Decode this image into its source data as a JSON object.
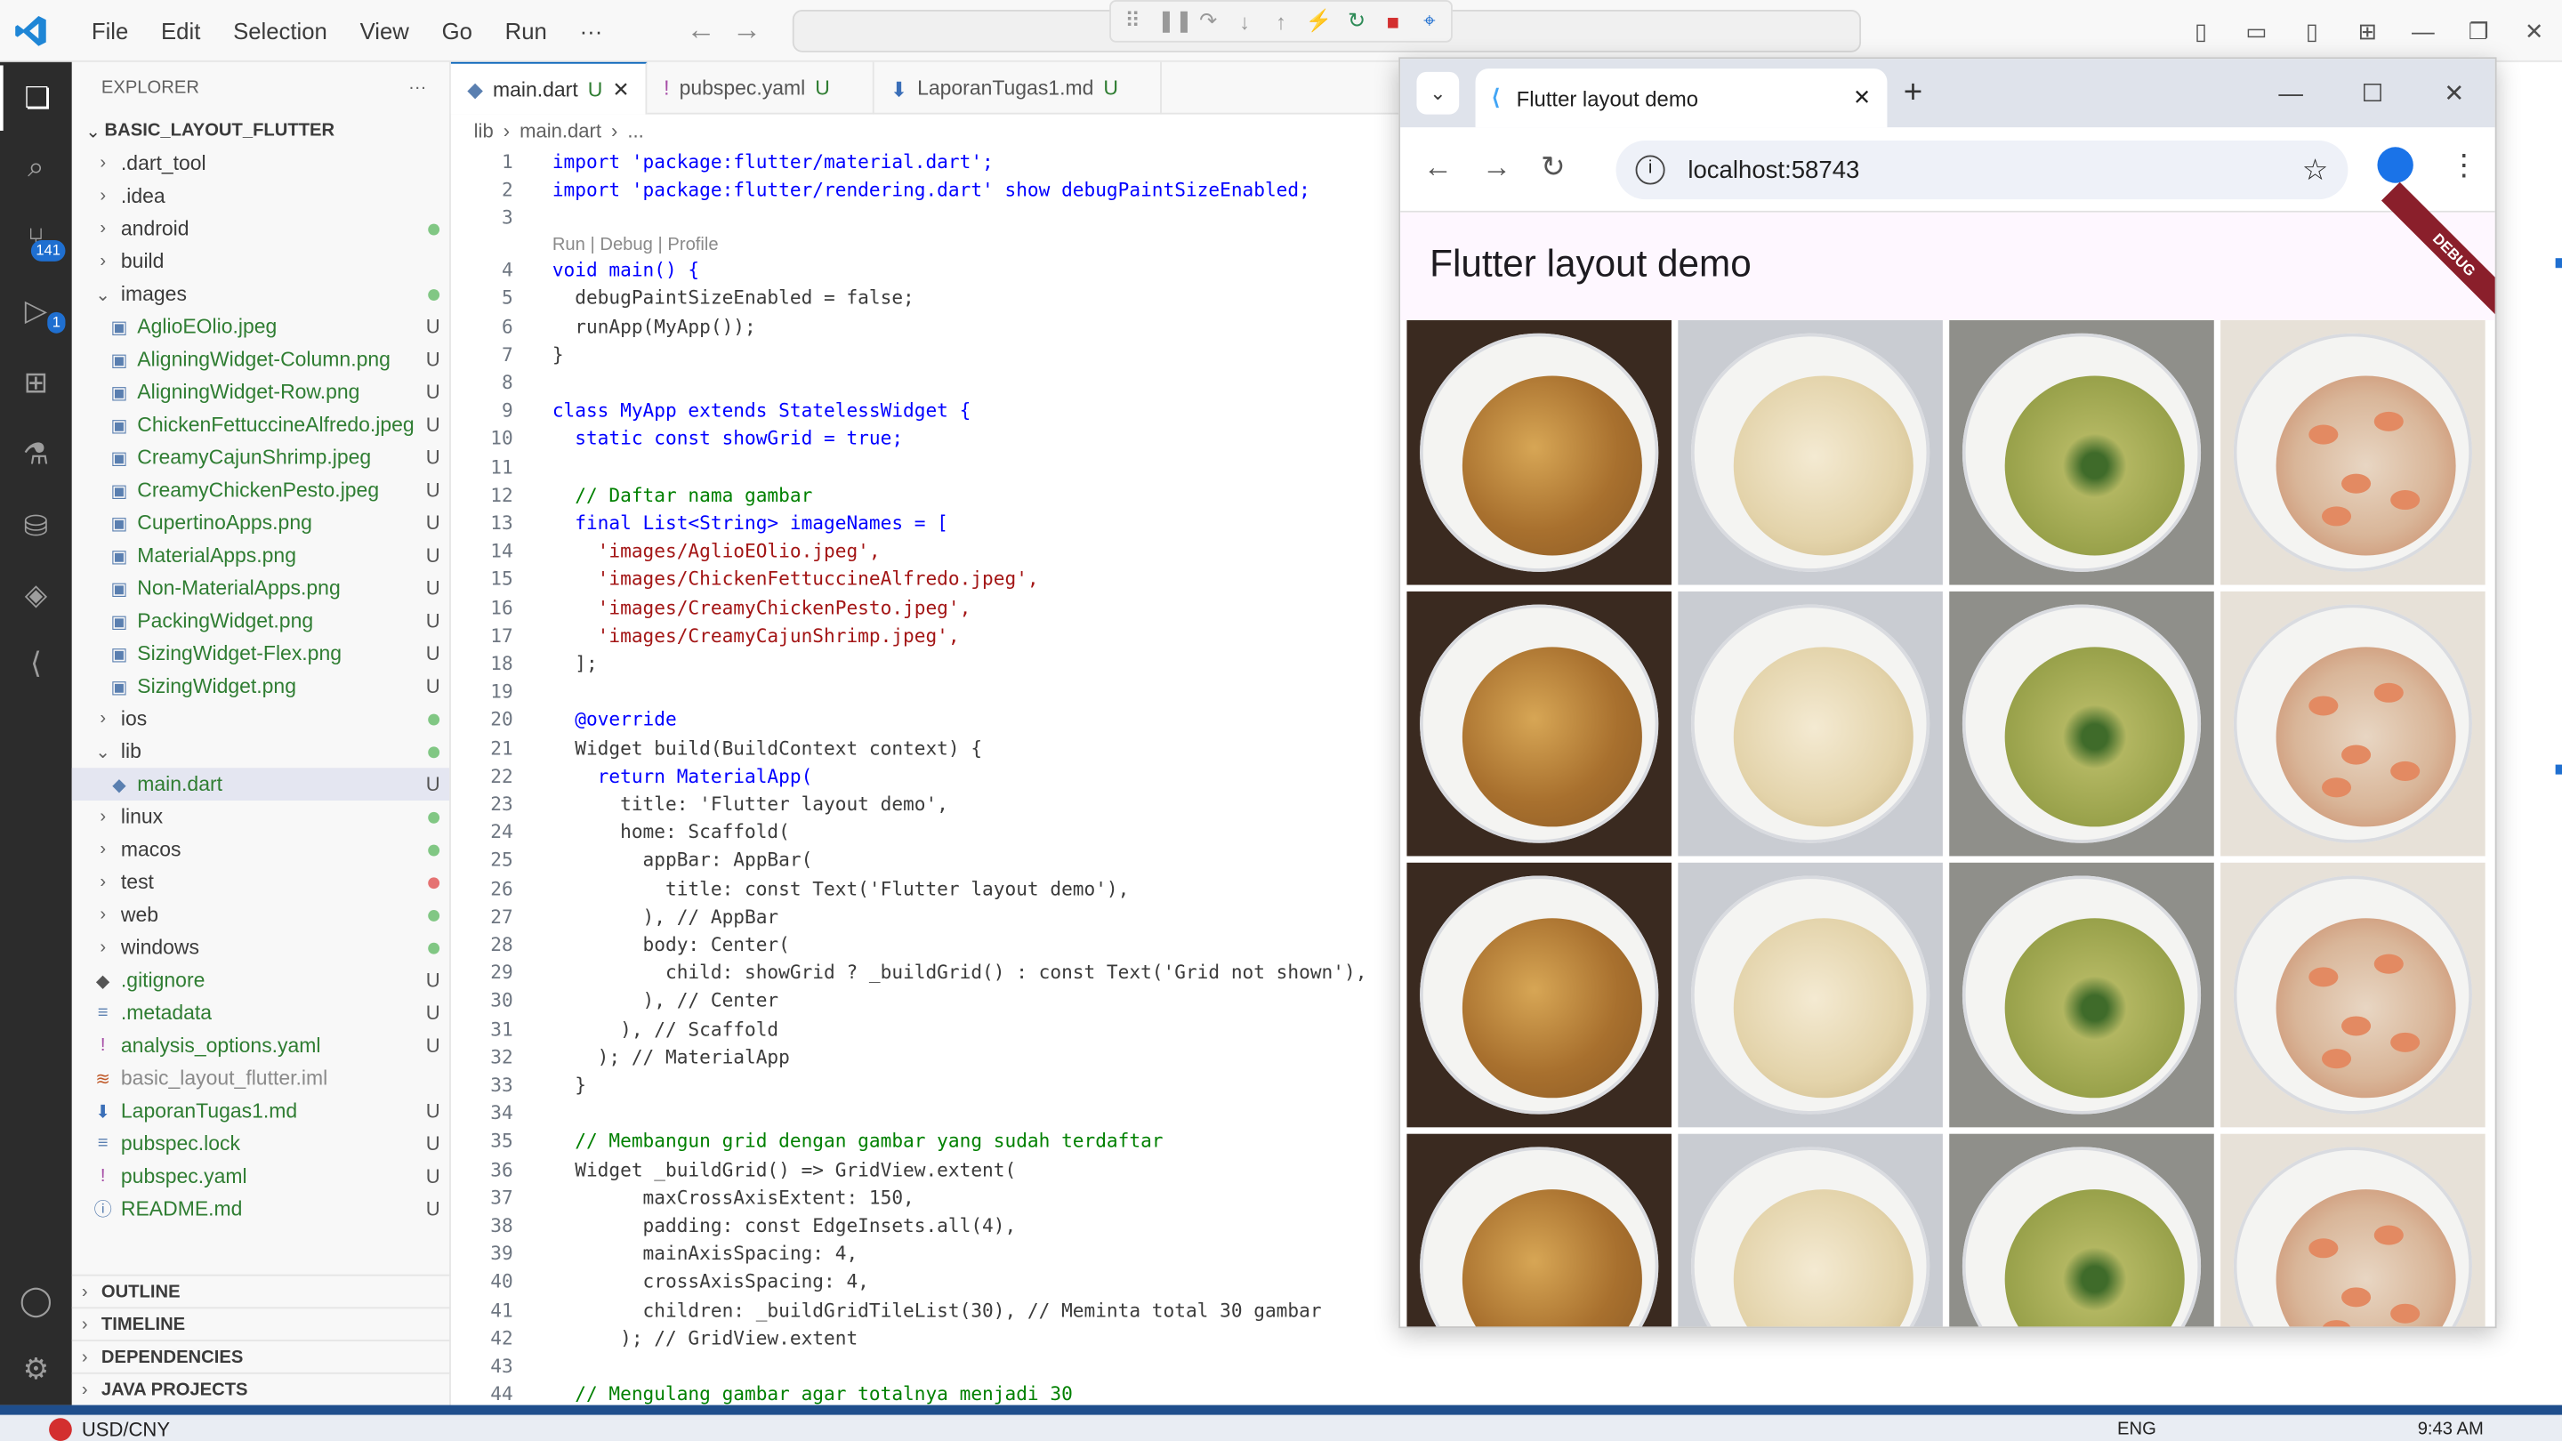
{
  "titlebar": {
    "menu": [
      "File",
      "Edit",
      "Selection",
      "View",
      "Go",
      "Run",
      "···"
    ]
  },
  "activity": {
    "scm_badge": "141",
    "debug_badge": "1"
  },
  "explorer": {
    "title": "EXPLORER",
    "more": "···",
    "root": "BASIC_LAYOUT_FLUTTER",
    "items": [
      {
        "label": ".dart_tool",
        "type": "folder",
        "status": ""
      },
      {
        "label": ".idea",
        "type": "folder",
        "status": ""
      },
      {
        "label": "android",
        "type": "folder",
        "status": "dot-green"
      },
      {
        "label": "build",
        "type": "folder",
        "status": ""
      },
      {
        "label": "images",
        "type": "folder-open",
        "status": "dot-green"
      },
      {
        "label": "AglioEOlio.jpeg",
        "type": "image",
        "status": "U"
      },
      {
        "label": "AligningWidget-Column.png",
        "type": "image",
        "status": "U"
      },
      {
        "label": "AligningWidget-Row.png",
        "type": "image",
        "status": "U"
      },
      {
        "label": "ChickenFettuccineAlfredo.jpeg",
        "type": "image",
        "status": "U"
      },
      {
        "label": "CreamyCajunShrimp.jpeg",
        "type": "image",
        "status": "U"
      },
      {
        "label": "CreamyChickenPesto.jpeg",
        "type": "image",
        "status": "U"
      },
      {
        "label": "CupertinoApps.png",
        "type": "image",
        "status": "U"
      },
      {
        "label": "MaterialApps.png",
        "type": "image",
        "status": "U"
      },
      {
        "label": "Non-MaterialApps.png",
        "type": "image",
        "status": "U"
      },
      {
        "label": "PackingWidget.png",
        "type": "image",
        "status": "U"
      },
      {
        "label": "SizingWidget-Flex.png",
        "type": "image",
        "status": "U"
      },
      {
        "label": "SizingWidget.png",
        "type": "image",
        "status": "U"
      },
      {
        "label": "ios",
        "type": "folder",
        "status": "dot-green"
      },
      {
        "label": "lib",
        "type": "folder-open",
        "status": "dot-green"
      },
      {
        "label": "main.dart",
        "type": "dart",
        "status": "U"
      },
      {
        "label": "linux",
        "type": "folder",
        "status": "dot-green"
      },
      {
        "label": "macos",
        "type": "folder",
        "status": "dot-green"
      },
      {
        "label": "test",
        "type": "folder",
        "status": "dot-red"
      },
      {
        "label": "web",
        "type": "folder",
        "status": "dot-green"
      },
      {
        "label": "windows",
        "type": "folder",
        "status": "dot-green"
      },
      {
        "label": ".gitignore",
        "type": "git",
        "status": "U"
      },
      {
        "label": ".metadata",
        "type": "file",
        "status": "U"
      },
      {
        "label": "analysis_options.yaml",
        "type": "yaml",
        "status": "U"
      },
      {
        "label": "basic_layout_flutter.iml",
        "type": "iml",
        "status": ""
      },
      {
        "label": "LaporanTugas1.md",
        "type": "md",
        "status": "U"
      },
      {
        "label": "pubspec.lock",
        "type": "file",
        "status": "U"
      },
      {
        "label": "pubspec.yaml",
        "type": "yaml",
        "status": "U"
      },
      {
        "label": "README.md",
        "type": "info",
        "status": "U"
      }
    ],
    "sections": [
      "OUTLINE",
      "TIMELINE",
      "DEPENDENCIES",
      "JAVA PROJECTS"
    ]
  },
  "editor": {
    "tabs": [
      {
        "label": "main.dart",
        "status": "U",
        "active": true
      },
      {
        "label": "pubspec.yaml",
        "status": "U",
        "active": false
      },
      {
        "label": "LaporanTugas1.md",
        "status": "U",
        "active": false
      }
    ],
    "breadcrumb": [
      "lib",
      "main.dart",
      "..."
    ],
    "codelens": "Run | Debug | Profile",
    "lines": [
      {
        "n": "1",
        "text": "import 'package:flutter/material.dart';"
      },
      {
        "n": "2",
        "text": "import 'package:flutter/rendering.dart' show debugPaintSizeEnabled;"
      },
      {
        "n": "3",
        "text": ""
      },
      {
        "n": "4",
        "text": "void main() {"
      },
      {
        "n": "5",
        "text": "  debugPaintSizeEnabled = false;"
      },
      {
        "n": "6",
        "text": "  runApp(MyApp());"
      },
      {
        "n": "7",
        "text": "}"
      },
      {
        "n": "8",
        "text": ""
      },
      {
        "n": "9",
        "text": "class MyApp extends StatelessWidget {"
      },
      {
        "n": "10",
        "text": "  static const showGrid = true;"
      },
      {
        "n": "11",
        "text": ""
      },
      {
        "n": "12",
        "text": "  // Daftar nama gambar"
      },
      {
        "n": "13",
        "text": "  final List<String> imageNames = ["
      },
      {
        "n": "14",
        "text": "    'images/AglioEOlio.jpeg',"
      },
      {
        "n": "15",
        "text": "    'images/ChickenFettuccineAlfredo.jpeg',"
      },
      {
        "n": "16",
        "text": "    'images/CreamyChickenPesto.jpeg',"
      },
      {
        "n": "17",
        "text": "    'images/CreamyCajunShrimp.jpeg',"
      },
      {
        "n": "18",
        "text": "  ];"
      },
      {
        "n": "19",
        "text": ""
      },
      {
        "n": "20",
        "text": "  @override"
      },
      {
        "n": "21",
        "text": "  Widget build(BuildContext context) {"
      },
      {
        "n": "22",
        "text": "    return MaterialApp("
      },
      {
        "n": "23",
        "text": "      title: 'Flutter layout demo',"
      },
      {
        "n": "24",
        "text": "      home: Scaffold("
      },
      {
        "n": "25",
        "text": "        appBar: AppBar("
      },
      {
        "n": "26",
        "text": "          title: const Text('Flutter layout demo'),"
      },
      {
        "n": "27",
        "text": "        ), // AppBar"
      },
      {
        "n": "28",
        "text": "        body: Center("
      },
      {
        "n": "29",
        "text": "          child: showGrid ? _buildGrid() : const Text('Grid not shown'),"
      },
      {
        "n": "30",
        "text": "        ), // Center"
      },
      {
        "n": "31",
        "text": "      ), // Scaffold"
      },
      {
        "n": "32",
        "text": "    ); // MaterialApp"
      },
      {
        "n": "33",
        "text": "  }"
      },
      {
        "n": "34",
        "text": ""
      },
      {
        "n": "35",
        "text": "  // Membangun grid dengan gambar yang sudah terdaftar"
      },
      {
        "n": "36",
        "text": "  Widget _buildGrid() => GridView.extent("
      },
      {
        "n": "37",
        "text": "        maxCrossAxisExtent: 150,"
      },
      {
        "n": "38",
        "text": "        padding: const EdgeInsets.all(4),"
      },
      {
        "n": "39",
        "text": "        mainAxisSpacing: 4,"
      },
      {
        "n": "40",
        "text": "        crossAxisSpacing: 4,"
      },
      {
        "n": "41",
        "text": "        children: _buildGridTileList(30), // Meminta total 30 gambar"
      },
      {
        "n": "42",
        "text": "      ); // GridView.extent"
      },
      {
        "n": "43",
        "text": ""
      },
      {
        "n": "44",
        "text": "  // Mengulang gambar agar totalnya menjadi 30"
      }
    ]
  },
  "browser": {
    "tab_title": "Flutter layout demo",
    "url": "localhost:58743",
    "app_title": "Flutter layout demo",
    "debug_banner": "DEBUG",
    "tiles": [
      "AglioEOlio",
      "ChickenFettuccineAlfredo",
      "CreamyChickenPesto",
      "CreamyCajunShrimp"
    ]
  },
  "taskbar": {
    "weather": "USD/CNY",
    "lang": "ENG",
    "time": "9:43 AM"
  },
  "colors": {
    "accent": "#005fb8",
    "statusbar": "#1f4e8c",
    "appbar_bg": "#fef7ff",
    "debug_ribbon": "#8a1f2b"
  }
}
